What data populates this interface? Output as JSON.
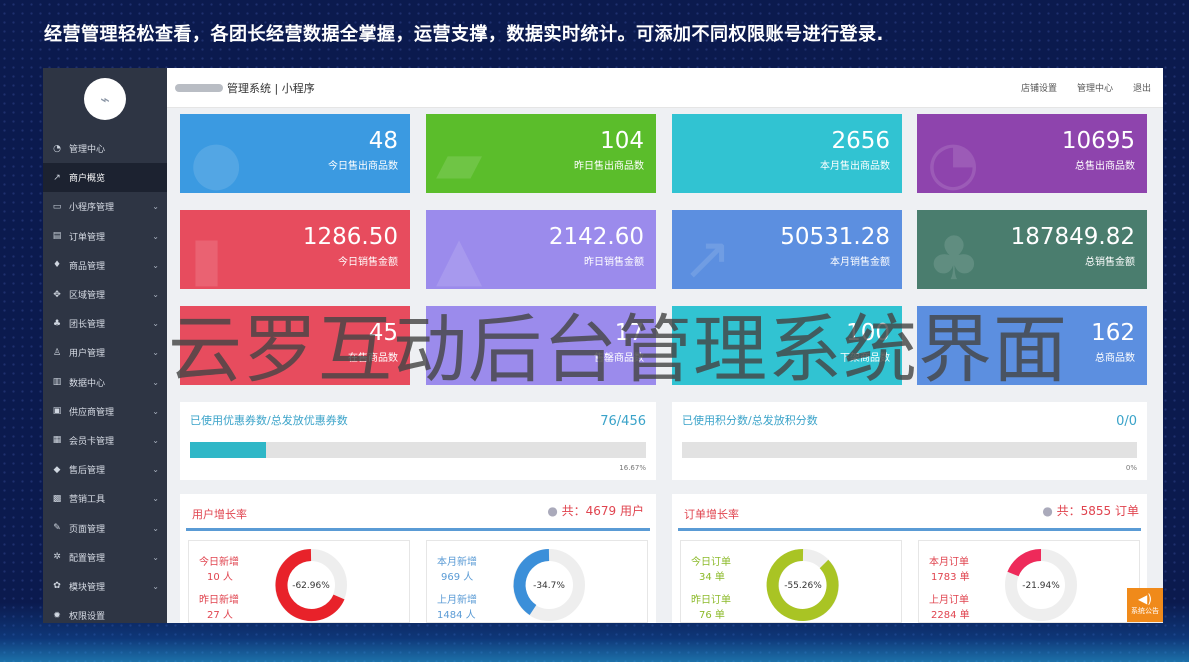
{
  "banner": "经营管理轻松查看，各团长经营数据全掌握，运营支撑，数据实时统计。可添加不同权限账号进行登录.",
  "header": {
    "brand": "管理系统 | 小程序",
    "links": [
      "店铺设置",
      "管理中心",
      "退出"
    ]
  },
  "sidebar": {
    "items": [
      {
        "label": "管理中心",
        "icon": "dashboard-icon"
      },
      {
        "label": "商户概览",
        "icon": "chart-line-icon"
      },
      {
        "label": "小程序管理",
        "icon": "monitor-icon"
      },
      {
        "label": "订单管理",
        "icon": "list-icon"
      },
      {
        "label": "商品管理",
        "icon": "gift-icon"
      },
      {
        "label": "区域管理",
        "icon": "region-icon"
      },
      {
        "label": "团长管理",
        "icon": "group-icon"
      },
      {
        "label": "用户管理",
        "icon": "user-icon"
      },
      {
        "label": "数据中心",
        "icon": "bar-chart-icon"
      },
      {
        "label": "供应商管理",
        "icon": "briefcase-icon"
      },
      {
        "label": "会员卡管理",
        "icon": "card-icon"
      },
      {
        "label": "售后管理",
        "icon": "shield-icon"
      },
      {
        "label": "营销工具",
        "icon": "toolbox-icon"
      },
      {
        "label": "页面管理",
        "icon": "brush-icon"
      },
      {
        "label": "配置管理",
        "icon": "cogs-icon"
      },
      {
        "label": "模块管理",
        "icon": "modules-icon"
      },
      {
        "label": "权限设置",
        "icon": "gear-icon"
      }
    ]
  },
  "stats_row1": [
    {
      "value": "48",
      "label": "今日售出商品数",
      "color": "#3b9ae1"
    },
    {
      "value": "104",
      "label": "昨日售出商品数",
      "color": "#5bbd2b"
    },
    {
      "value": "2656",
      "label": "本月售出商品数",
      "color": "#31c3d2"
    },
    {
      "value": "10695",
      "label": "总售出商品数",
      "color": "#8e44ad"
    }
  ],
  "stats_row2": [
    {
      "value": "1286.50",
      "label": "今日销售金额",
      "color": "#e74c5e"
    },
    {
      "value": "2142.60",
      "label": "昨日销售金额",
      "color": "#9b8bec"
    },
    {
      "value": "50531.28",
      "label": "本月销售金额",
      "color": "#5c8fe0"
    },
    {
      "value": "187849.82",
      "label": "总销售金额",
      "color": "#4a7d6e"
    }
  ],
  "stats_row3": [
    {
      "value": "45",
      "label": "在售商品数",
      "color": "#e74c5e"
    },
    {
      "value": "17",
      "label": "售罄商品数",
      "color": "#9b8bec"
    },
    {
      "value": "100",
      "label": "下架商品数",
      "color": "#31c3d2"
    },
    {
      "value": "162",
      "label": "总商品数",
      "color": "#5c8fe0"
    }
  ],
  "coupon": {
    "title": "已使用优惠券数/总发放优惠券数",
    "value": "76/456",
    "percent_text": "16.67%",
    "fraction": 0.1667
  },
  "points": {
    "title": "已使用积分数/总发放积分数",
    "value": "0/0",
    "percent_text": "0%",
    "fraction": 0
  },
  "user_growth": {
    "title": "用户增长率",
    "total_label": "共：",
    "total_value": "4679 用户",
    "today_label": "今日新增",
    "today_value": "10 人",
    "yesterday_label": "昨日新增",
    "yesterday_value": "27 人",
    "daily_rate": "-62.96%",
    "month_label": "本月新增",
    "month_value": "969 人",
    "lastmonth_label": "上月新增",
    "lastmonth_value": "1484 人",
    "monthly_rate": "-34.7%"
  },
  "order_growth": {
    "title": "订单增长率",
    "total_label": "共：",
    "total_value": "5855 订单",
    "today_label": "今日订单",
    "today_value": "34 单",
    "yesterday_label": "昨日订单",
    "yesterday_value": "76 单",
    "daily_rate": "-55.26%",
    "month_label": "本月订单",
    "month_value": "1783 单",
    "lastmonth_label": "上月订单",
    "lastmonth_value": "2284 单",
    "monthly_rate": "-21.94%"
  },
  "watermark": "云罗互动后台管理系统界面",
  "notice": "系统公告"
}
